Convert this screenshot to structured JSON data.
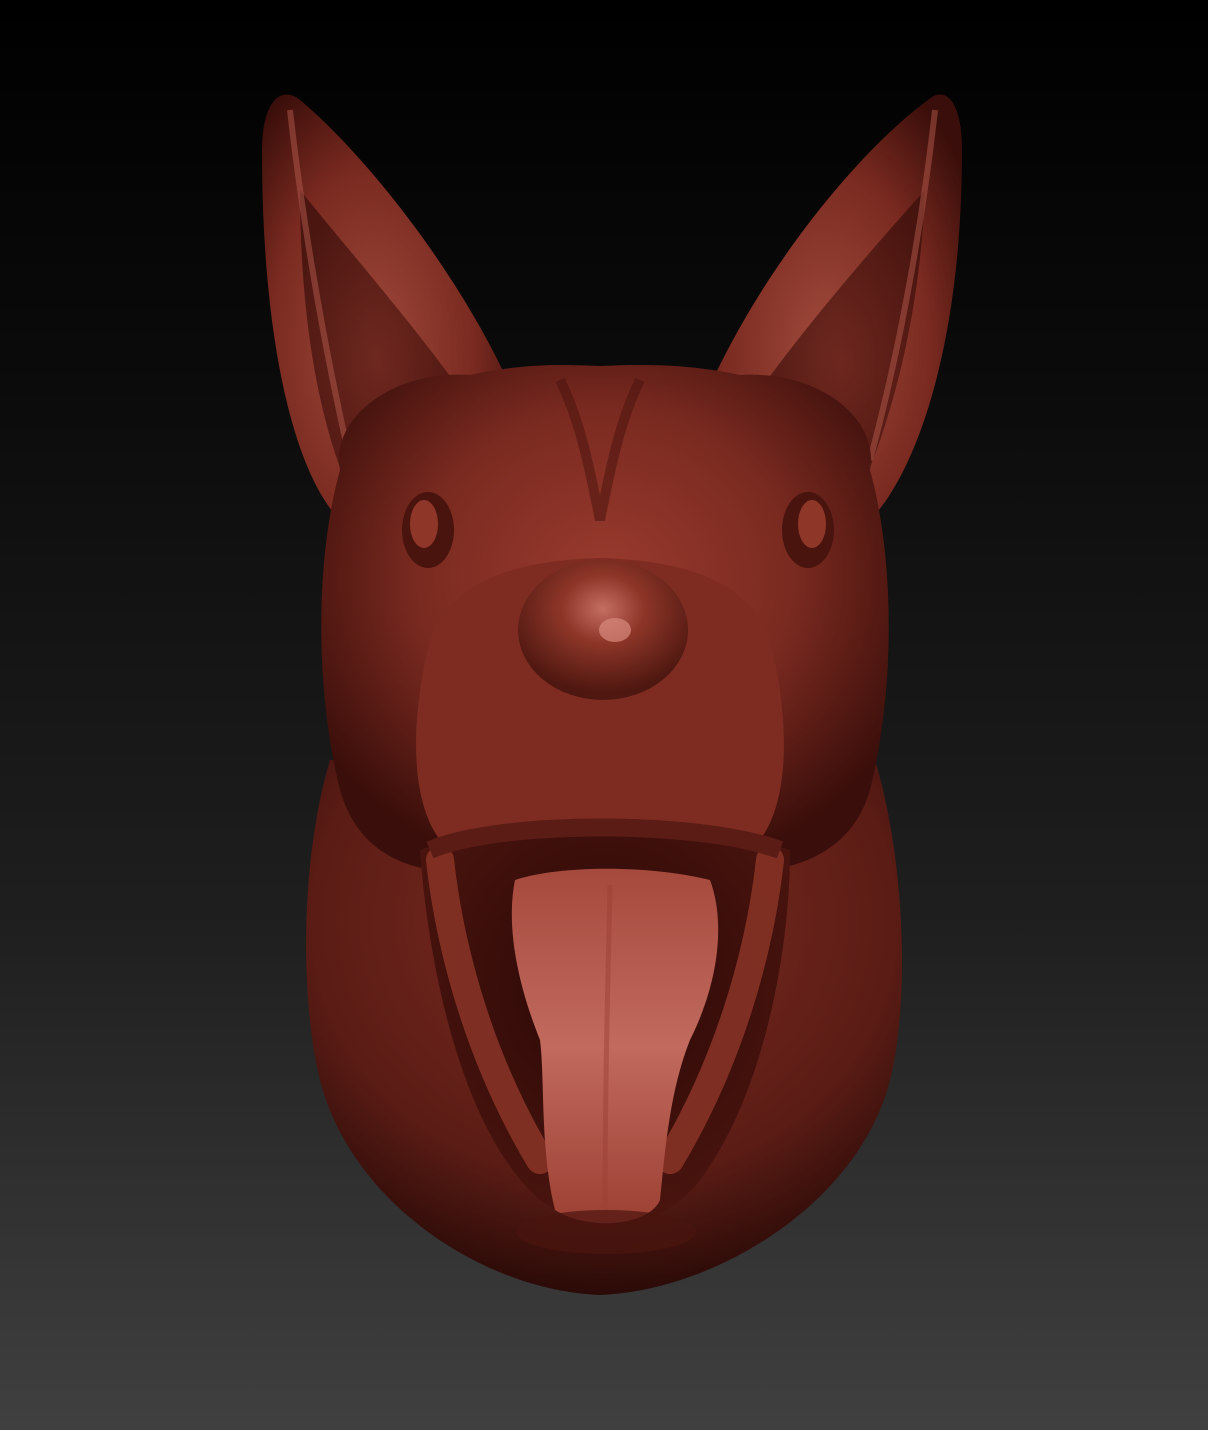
{
  "viewport": {
    "background_top": "#000000",
    "background_bottom": "#404040"
  },
  "sculpt": {
    "subject": "dog-head",
    "material_color": "#7a2a20",
    "highlight_color": "#b4584a",
    "shadow_color": "#2a0906",
    "tongue_color": "#c56a5e"
  }
}
